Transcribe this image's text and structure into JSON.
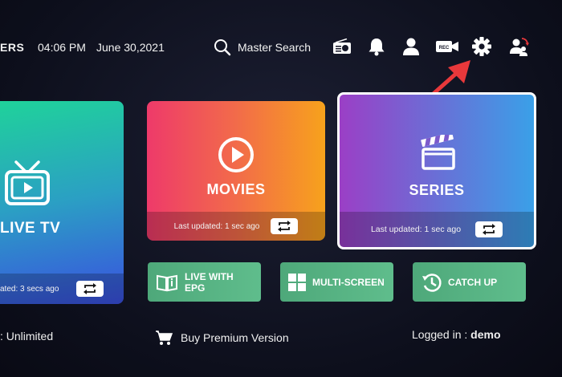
{
  "header": {
    "brand_fragment": "ERS",
    "time": "04:06 PM",
    "date": "June 30,2021",
    "search_label": "Master Search"
  },
  "top_icons": [
    "radio-icon",
    "bell-icon",
    "user-icon",
    "rec-camera-icon",
    "gear-icon",
    "switch-user-icon"
  ],
  "rec_text": "REC",
  "cards": {
    "live_tv": {
      "title": "LIVE TV",
      "footer": "ated: 3 secs ago"
    },
    "movies": {
      "title": "MOVIES",
      "footer": "Last updated: 1 sec ago"
    },
    "series": {
      "title": "SERIES",
      "footer": "Last updated: 1 sec ago"
    }
  },
  "buttons": {
    "live_epg_line1": "LIVE WITH",
    "live_epg_line2": "EPG",
    "multiscreen": "MULTI-SCREEN",
    "catchup": "CATCH UP"
  },
  "bottom": {
    "subscription": ": Unlimited",
    "buy_premium": "Buy Premium Version",
    "logged_in_label": "Logged in : ",
    "logged_in_user": "demo"
  },
  "colors": {
    "accent_arrow": "#e8383b",
    "movies_gradient": [
      "#ee3a6a",
      "#f7a21c"
    ],
    "series_gradient": [
      "#9b3fc6",
      "#3aa0e8"
    ],
    "live_tv_gradient": [
      "#1fd39a",
      "#3a4fe0"
    ],
    "green_button": "#55b182"
  }
}
